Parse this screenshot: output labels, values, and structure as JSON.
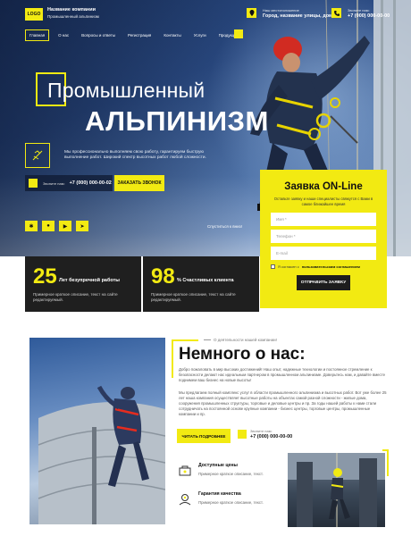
{
  "header": {
    "logo": "LOGO",
    "company_name": "Название компании",
    "company_sub": "Промышленный альпинизм",
    "location_label": "Наш местоположение",
    "location_value": "Город, название улицы, дом",
    "phone_label": "Звоните нам:",
    "phone_value": "+7 (000) 000-00-00"
  },
  "nav": {
    "items": [
      "Главная",
      "О нас",
      "Вопросы и ответы",
      "Регистрация",
      "Контакты",
      "Услуги",
      "Продукция"
    ],
    "active": "Главная"
  },
  "hero": {
    "title_line1": "Промышленный",
    "title_line2": "АЛЬПИНИЗМ",
    "description": "Мы профессионально выполняем свою работу, гарантируем быструю выполнение работ. Широкий спектр высотных работ любой сложности.",
    "phone_label": "Звоните нам:",
    "phone_value": "+7 (000) 000-00-02",
    "call_button": "ЗАКАЗАТЬ ЗВОНОК",
    "scroll_hint": "Спуститься к вниз!",
    "social": [
      "vk-icon",
      "odnoklassniki-icon",
      "youtube-icon",
      "telegram-icon"
    ]
  },
  "form": {
    "title": "Заявка ON-Line",
    "subtitle": "Оставьте заявку и наши специалисты свяжутся с Вами в самое ближайшее время",
    "name_placeholder": "Имя *",
    "phone_placeholder": "Телефон *",
    "email_placeholder": "E-mail",
    "agree_text": "Я согласен с ",
    "agree_link": "пользовательским соглашением",
    "submit": "ОТПРАВИТЬ ЗАЯВКУ"
  },
  "stats": [
    {
      "number": "25",
      "label": "Лет безупречной работы",
      "text": "Примерное краткое описание, текст на сайте редактируемый."
    },
    {
      "number": "98",
      "label": "% Счастливых клиента",
      "text": "Примерное краткое описание, текст на сайте редактируемый."
    }
  ],
  "about": {
    "pre_title": "О деятельности нашей компании!",
    "title": "Немного о нас:",
    "para1": "Добро пожаловать в мир высоких достижений! Наш опыт, надежные технологии и постоянное стремление к безопасности делают нас идеальным партнером в промышленном альпинизме. Доверьтесь нам, и давайте вместе поднимем ваш бизнес на новые высоты!",
    "para2": "Мы предлагаем полный комплекс услуг в области промышленного альпинизма и высотных работ. Вот уже более 25 лет наша компания осуществляет высотные работы на объектах самой разной сложности - жилые дома, сооружения промышленных структуры, торговые и деловые центры и пр. За годы нашей работы к нами стали сотрудничать на постоянной основе крупные компании - бизнес центры, торговые центры, промышленные компании и пр.",
    "button": "ЧИТАТЬ ПОДРОБНЕЕ",
    "phone_label": "Звоните нам:",
    "phone_value": "+7 (000) 000-00-00",
    "features": [
      {
        "title": "Доступные цены",
        "text": "Примерное краткое описание, текст."
      },
      {
        "title": "Гарантия качества",
        "text": "Примерное краткое описание, текст."
      }
    ]
  },
  "colors": {
    "accent": "#f2ea12",
    "dark": "#1f1f1f"
  }
}
